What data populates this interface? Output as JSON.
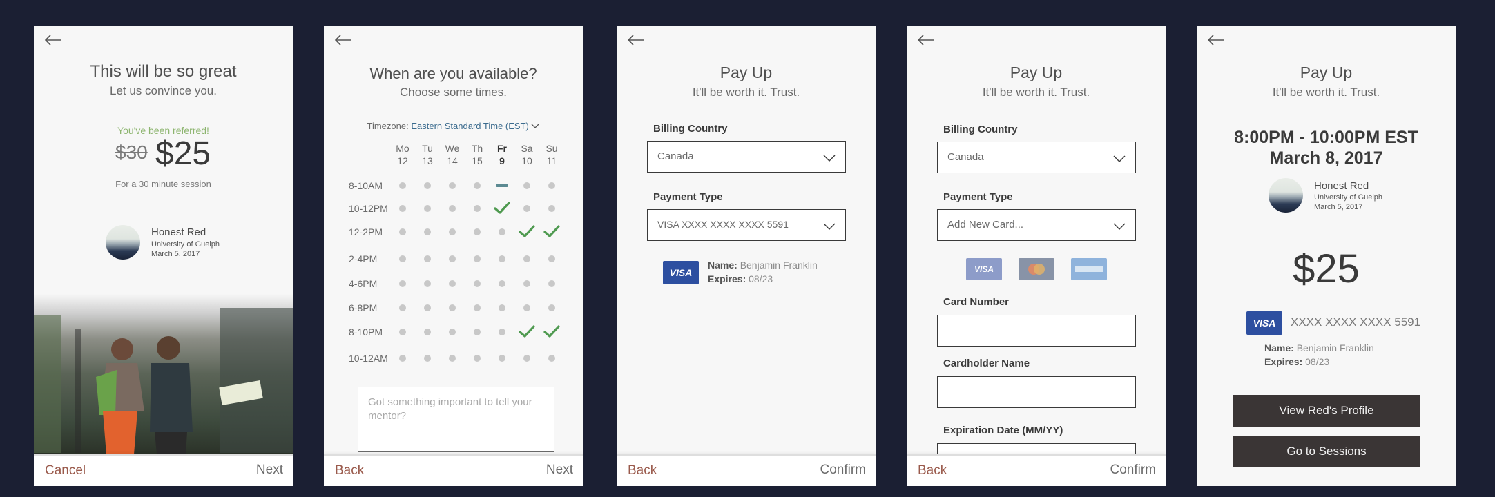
{
  "screen1": {
    "title": "This will be so great",
    "subtitle": "Let us convince you.",
    "referred": "You've been referred!",
    "old_price": "$30",
    "new_price": "$25",
    "session_note": "For a 30 minute session",
    "mentor": {
      "name": "Honest Red",
      "school": "University of Guelph",
      "date": "March 5, 2017"
    },
    "cancel": "Cancel",
    "next": "Next"
  },
  "screen2": {
    "title": "When are you available?",
    "subtitle": "Choose some times.",
    "timezone_label": "Timezone:",
    "timezone_value": "Eastern Standard Time (EST)",
    "days": [
      {
        "name": "Mo",
        "num": "12",
        "bold": false
      },
      {
        "name": "Tu",
        "num": "13",
        "bold": false
      },
      {
        "name": "We",
        "num": "14",
        "bold": false
      },
      {
        "name": "Th",
        "num": "15",
        "bold": false
      },
      {
        "name": "Fr",
        "num": "9",
        "bold": true
      },
      {
        "name": "Sa",
        "num": "10",
        "bold": false
      },
      {
        "name": "Su",
        "num": "11",
        "bold": false
      }
    ],
    "slots": [
      {
        "label": "8-10AM",
        "states": [
          "dot",
          "dot",
          "dot",
          "dot",
          "bar",
          "dot",
          "dot"
        ]
      },
      {
        "label": "10-12PM",
        "states": [
          "dot",
          "dot",
          "dot",
          "dot",
          "check",
          "dot",
          "dot"
        ]
      },
      {
        "label": "12-2PM",
        "states": [
          "dot",
          "dot",
          "dot",
          "dot",
          "dot",
          "check",
          "check"
        ]
      },
      {
        "label": "2-4PM",
        "states": [
          "dot",
          "dot",
          "dot",
          "dot",
          "dot",
          "dot",
          "dot"
        ]
      },
      {
        "label": "4-6PM",
        "states": [
          "dot",
          "dot",
          "dot",
          "dot",
          "dot",
          "dot",
          "dot"
        ]
      },
      {
        "label": "6-8PM",
        "states": [
          "dot",
          "dot",
          "dot",
          "dot",
          "dot",
          "dot",
          "dot"
        ]
      },
      {
        "label": "8-10PM",
        "states": [
          "dot",
          "dot",
          "dot",
          "dot",
          "dot",
          "check",
          "check"
        ]
      },
      {
        "label": "10-12AM",
        "states": [
          "dot",
          "dot",
          "dot",
          "dot",
          "dot",
          "dot",
          "dot"
        ]
      }
    ],
    "note_placeholder": "Got something important to tell your mentor?",
    "back": "Back",
    "next": "Next"
  },
  "screen3": {
    "title": "Pay Up",
    "subtitle": "It'll be worth it. Trust.",
    "billing_label": "Billing Country",
    "billing_value": "Canada",
    "payment_label": "Payment Type",
    "payment_value": "VISA XXXX XXXX XXXX 5591",
    "card_brand": "VISA",
    "name_label": "Name:",
    "name_value": "Benjamin Franklin",
    "expires_label": "Expires:",
    "expires_value": "08/23",
    "back": "Back",
    "confirm": "Confirm"
  },
  "screen4": {
    "title": "Pay Up",
    "subtitle": "It'll be worth it. Trust.",
    "billing_label": "Billing Country",
    "billing_value": "Canada",
    "payment_label": "Payment Type",
    "payment_value": "Add New Card...",
    "card_visa": "VISA",
    "card_number_label": "Card Number",
    "cardholder_label": "Cardholder Name",
    "expiration_label": "Expiration Date (MM/YY)",
    "back": "Back",
    "confirm": "Confirm"
  },
  "screen5": {
    "title": "Pay Up",
    "subtitle": "It'll be worth it. Trust.",
    "time": "8:00PM - 10:00PM EST",
    "date": "March 8, 2017",
    "mentor": {
      "name": "Honest Red",
      "school": "University of Guelph",
      "date": "March 5, 2017"
    },
    "total": "$25",
    "card_brand": "VISA",
    "card_number": "XXXX XXXX XXXX 5591",
    "name_label": "Name:",
    "name_value": "Benjamin Franklin",
    "expires_label": "Expires:",
    "expires_value": "08/23",
    "profile_button": "View Red's Profile",
    "sessions_button": "Go to Sessions"
  },
  "colors": {
    "background": "#1b1f33",
    "accent_red": "#9a5a4c",
    "check_green": "#4f9a50",
    "visa_blue": "#2d4fa0"
  }
}
